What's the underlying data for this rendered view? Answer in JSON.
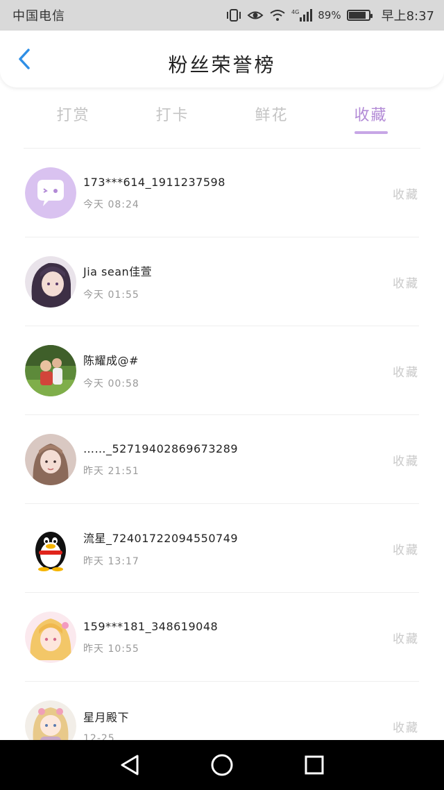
{
  "status_bar": {
    "carrier": "中国电信",
    "battery_percent": "89%",
    "time": "早上8:37",
    "network": "4G"
  },
  "header": {
    "title": "粉丝荣誉榜"
  },
  "tabs": [
    {
      "label": "打赏",
      "active": false
    },
    {
      "label": "打卡",
      "active": false
    },
    {
      "label": "鲜花",
      "active": false
    },
    {
      "label": "收藏",
      "active": true
    }
  ],
  "fans": [
    {
      "name": "173***614_1911237598",
      "time": "今天 08:24",
      "action": "收藏",
      "avatar": "chat-bubble-avatar"
    },
    {
      "name": "Jia sean佳萱",
      "time": "今天 01:55",
      "action": "收藏",
      "avatar": "anime-girl-avatar"
    },
    {
      "name": "陈耀成@#",
      "time": "今天 00:58",
      "action": "收藏",
      "avatar": "photo-avatar"
    },
    {
      "name": "……_52719402869673289",
      "time": "昨天 21:51",
      "action": "收藏",
      "avatar": "girl-photo-avatar"
    },
    {
      "name": "流星_72401722094550749",
      "time": "昨天 13:17",
      "action": "收藏",
      "avatar": "penguin-avatar"
    },
    {
      "name": "159***181_348619048",
      "time": "昨天 10:55",
      "action": "收藏",
      "avatar": "blonde-anime-avatar"
    },
    {
      "name": "星月殿下",
      "time": "12-25",
      "action": "收藏",
      "avatar": "chibi-anime-avatar"
    }
  ],
  "colors": {
    "accent": "#b28ad6",
    "back_arrow": "#2f8fe6",
    "status_bar_bg": "#d9d9d9"
  }
}
